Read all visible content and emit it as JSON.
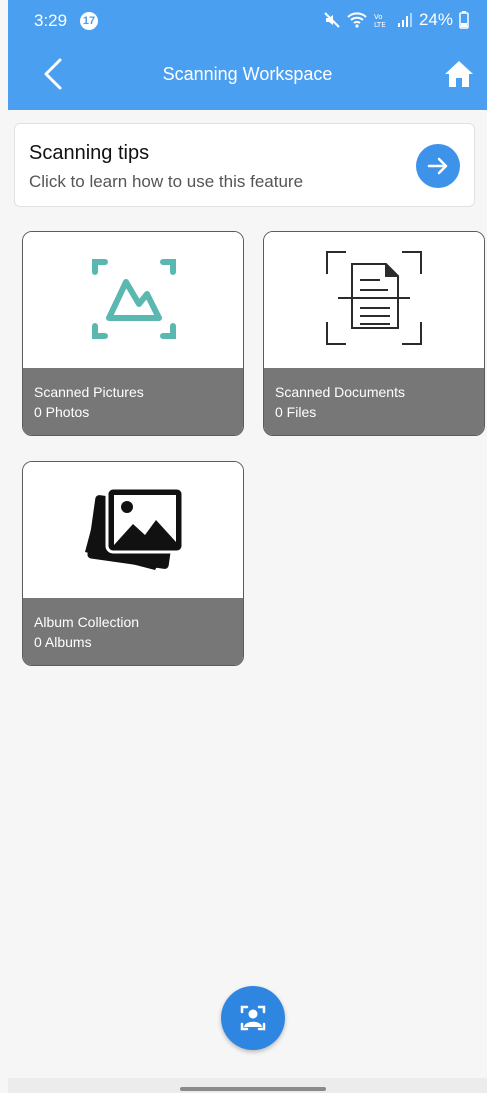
{
  "status_bar": {
    "time": "3:29",
    "notification_count": "17",
    "battery": "24%",
    "icons": [
      "mute-icon",
      "wifi-icon",
      "volte-icon",
      "signal-icon",
      "battery-icon"
    ]
  },
  "header": {
    "title": "Scanning Workspace",
    "back_icon": "back-chevron-icon",
    "home_icon": "home-icon"
  },
  "tips": {
    "title": "Scanning tips",
    "subtitle": "Click to learn how to use this feature",
    "icon": "arrow-right-icon"
  },
  "cards": [
    {
      "title": "Scanned Pictures",
      "count": "0 Photos",
      "icon": "scan-picture-icon"
    },
    {
      "title": "Scanned Documents",
      "count": "0 Files",
      "icon": "scan-document-icon"
    },
    {
      "title": "Album Collection",
      "count": "0 Albums",
      "icon": "album-collection-icon"
    }
  ],
  "fab": {
    "icon": "scan-person-icon"
  },
  "colors": {
    "primary": "#4a9ff0",
    "fab": "#2f86e0",
    "teal": "#5bb8b0",
    "card_footer": "#777777"
  }
}
